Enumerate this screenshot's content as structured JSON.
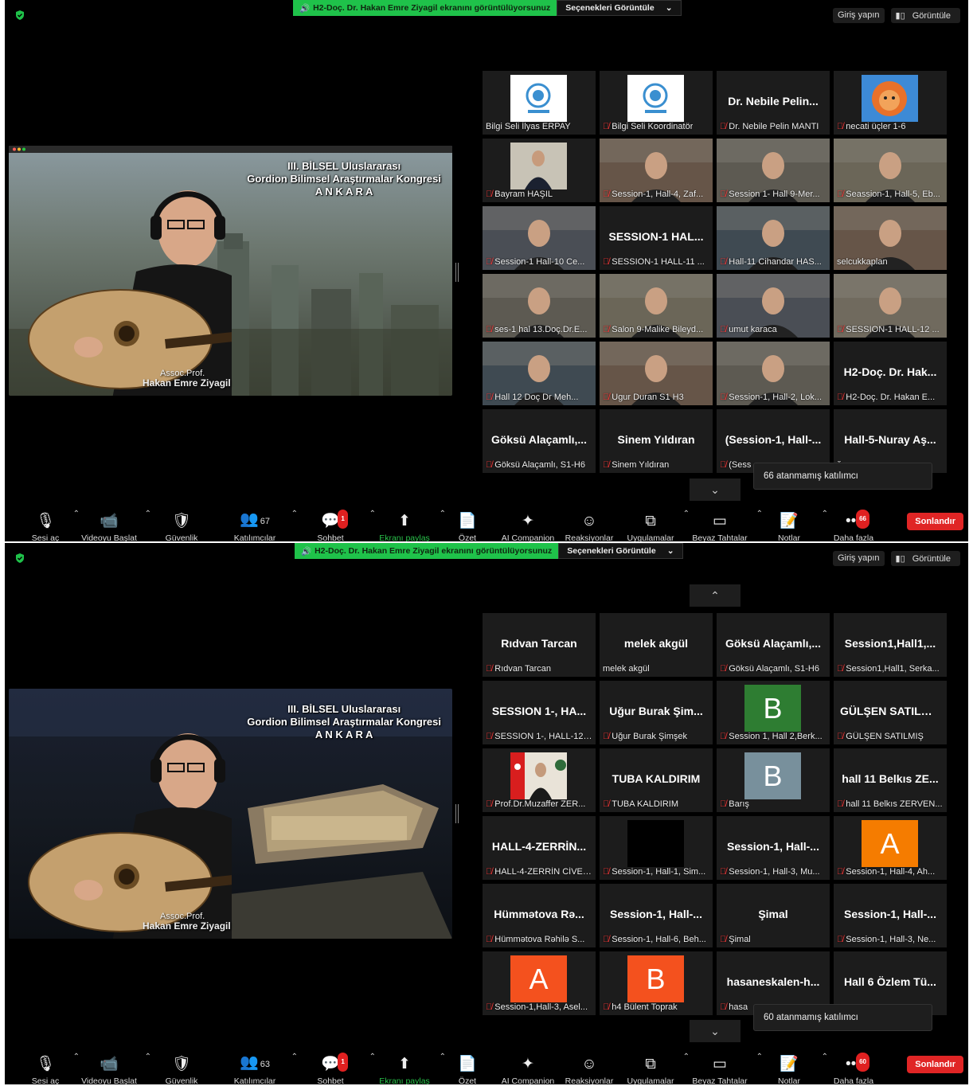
{
  "windows": [
    {
      "banner_text": "H2-Doç. Dr. Hakan Emre Ziyagil ekranını görüntülüyorsunuz",
      "options_label": "Seçenekleri Görüntüle",
      "sign_in": "Giriş yapın",
      "view_label": "Görüntüle",
      "screen": {
        "title": [
          "III. BİLSEL Uluslararası",
          "Gordion Bilimsel Araştırmalar Kongresi",
          "A N K A R A"
        ],
        "caption_role": "Assoc.Prof.",
        "caption_name": "Hakan Emre Ziyagil"
      },
      "tiles": [
        {
          "name": "Bilgi Seli İlyas ERPAY",
          "muted": false,
          "kind": "logo"
        },
        {
          "name": "Bilgi Seli Koordinatör",
          "muted": true,
          "kind": "logo"
        },
        {
          "name": "Dr. Nebile Pelin MANTI",
          "muted": true,
          "kind": "text",
          "big": "Dr. Nebile Pelin..."
        },
        {
          "name": "necati üçler 1-6",
          "muted": true,
          "kind": "lion"
        },
        {
          "name": "Bayram HAŞIL",
          "muted": true,
          "kind": "photo"
        },
        {
          "name": "Session-1, Hall-4, Zaf...",
          "muted": true,
          "kind": "video"
        },
        {
          "name": "Session 1- Hall 9-Mer...",
          "muted": true,
          "kind": "video"
        },
        {
          "name": "Seassion-1, Hall-5, Eb...",
          "muted": true,
          "kind": "video"
        },
        {
          "name": "Session-1  Hall-10 Ce...",
          "muted": true,
          "kind": "video"
        },
        {
          "name": "SESSION-1 HALL-11 ...",
          "muted": true,
          "kind": "text",
          "big": "SESSION-1 HAL..."
        },
        {
          "name": "Hall-11 Cihandar HAS...",
          "muted": true,
          "kind": "video"
        },
        {
          "name": "selcukkaplan",
          "muted": false,
          "kind": "video"
        },
        {
          "name": "ses-1 hal 13.Doç.Dr.E...",
          "muted": true,
          "kind": "video"
        },
        {
          "name": "Salon 9-Malike Bileyd...",
          "muted": true,
          "kind": "video"
        },
        {
          "name": "umut karaca",
          "muted": true,
          "kind": "video"
        },
        {
          "name": "SESSION-1 HALL-12 ...",
          "muted": true,
          "kind": "video"
        },
        {
          "name": "Hall 12  Doç Dr Meh...",
          "muted": true,
          "kind": "video",
          "highlight": true
        },
        {
          "name": "Ugur Duran S1 H3",
          "muted": true,
          "kind": "video"
        },
        {
          "name": "Session-1, Hall-2, Lok...",
          "muted": true,
          "kind": "video"
        },
        {
          "name": "H2-Doç. Dr. Hakan E...",
          "muted": true,
          "kind": "text",
          "big": "H2-Doç. Dr. Hak..."
        },
        {
          "name": "Göksü Alaçamlı, S1-H6",
          "muted": true,
          "kind": "text",
          "big": "Göksü  Alaçamlı,..."
        },
        {
          "name": "Sinem Yıldıran",
          "muted": true,
          "kind": "text",
          "big": "Sinem Yıldıran"
        },
        {
          "name": "(Sess",
          "muted": true,
          "kind": "text",
          "big": "(Session-1,  Hall-..."
        },
        {
          "name": "ğ...",
          "muted": false,
          "kind": "text",
          "big": "Hall-5-Nuray Aş..."
        }
      ],
      "popup": "66 atanmamış katılımcı",
      "participants_count": "67",
      "chat_badge": "1",
      "more_badge": "66"
    },
    {
      "banner_text": "H2-Doç. Dr. Hakan Emre Ziyagil ekranını görüntülüyorsunuz",
      "options_label": "Seçenekleri Görüntüle",
      "sign_in": "Giriş yapın",
      "view_label": "Görüntüle",
      "screen": {
        "title": [
          "III. BİLSEL Uluslararası",
          "Gordion Bilimsel Araştırmalar Kongresi",
          "A N K A R A"
        ],
        "caption_role": "Assoc.Prof.",
        "caption_name": "Hakan Emre Ziyagil"
      },
      "tiles": [
        {
          "name": "Rıdvan Tarcan",
          "muted": true,
          "kind": "text",
          "big": "Rıdvan Tarcan"
        },
        {
          "name": "melek akgül",
          "muted": false,
          "kind": "text",
          "big": "melek akgül"
        },
        {
          "name": "Göksü Alaçamlı, S1-H6",
          "muted": true,
          "kind": "text",
          "big": "Göksü  Alaçamlı,..."
        },
        {
          "name": "Session1,Hall1, Serka...",
          "muted": true,
          "kind": "text",
          "big": "Session1,Hall1,..."
        },
        {
          "name": "SESSION 1-, HALL-12,...",
          "muted": true,
          "kind": "text",
          "big": "SESSION  1-,  HA..."
        },
        {
          "name": "Uğur Burak Şimşek",
          "muted": true,
          "kind": "text",
          "big": "Uğur Burak Şim..."
        },
        {
          "name": "Session 1, Hall 2,Berk...",
          "muted": true,
          "kind": "letter",
          "letter": "B",
          "color": "#2e7d32"
        },
        {
          "name": "GÜLŞEN SATILMIŞ",
          "muted": true,
          "kind": "text",
          "big": "GÜLŞEN SATILMIŞ"
        },
        {
          "name": "Prof.Dr.Muzaffer ZER...",
          "muted": true,
          "kind": "flag"
        },
        {
          "name": "TUBA KALDIRIM",
          "muted": true,
          "kind": "text",
          "big": "TUBA KALDIRIM"
        },
        {
          "name": "Barış",
          "muted": true,
          "kind": "letter",
          "letter": "B",
          "color": "#78909c"
        },
        {
          "name": "hall 11 Belkıs ZERVEN...",
          "muted": true,
          "kind": "text",
          "big": "hall 11 Belkıs ZE..."
        },
        {
          "name": "HALL-4-ZERRİN CİVEL...",
          "muted": true,
          "kind": "text",
          "big": "HALL-4-ZERRİN..."
        },
        {
          "name": "Session-1, Hall-1, Sim...",
          "muted": true,
          "kind": "black"
        },
        {
          "name": "Session-1, Hall-3, Mu...",
          "muted": true,
          "kind": "text",
          "big": "Session-1,  Hall-..."
        },
        {
          "name": "Session-1, Hall-4, Ah...",
          "muted": true,
          "kind": "letter",
          "letter": "A",
          "color": "#f57c00"
        },
        {
          "name": "Hümmətova Rəhilə S...",
          "muted": true,
          "kind": "text",
          "big": "Hümmətova  Rə..."
        },
        {
          "name": "Session-1, Hall-6, Beh...",
          "muted": true,
          "kind": "text",
          "big": "Session-1,  Hall-..."
        },
        {
          "name": "Şimal",
          "muted": true,
          "kind": "text",
          "big": "Şimal"
        },
        {
          "name": "Session-1, Hall-3, Ne...",
          "muted": true,
          "kind": "text",
          "big": "Session-1,  Hall-..."
        },
        {
          "name": "Session-1,Hall-3, Asel...",
          "muted": true,
          "kind": "letter",
          "letter": "A",
          "color": "#f4511e"
        },
        {
          "name": "h4 Bülent Toprak",
          "muted": true,
          "kind": "letter",
          "letter": "B",
          "color": "#f4511e"
        },
        {
          "name": "hasa",
          "muted": true,
          "kind": "text",
          "big": "hasaneskalen-h..."
        },
        {
          "name": "y...",
          "muted": false,
          "kind": "text",
          "big": "Hall 6 Özlem Tü..."
        }
      ],
      "popup": "60 atanmamış katılımcı",
      "participants_count": "63",
      "chat_badge": "1",
      "more_badge": "60"
    }
  ],
  "toolbar": {
    "unmute": "Sesi aç",
    "start_video": "Videoyu Başlat",
    "security": "Güvenlik",
    "participants": "Katılımcılar",
    "chat": "Sohbet",
    "share": "Ekranı paylaş",
    "summary": "Özet",
    "ai": "AI Companion",
    "reactions": "Reaksiyonlar",
    "apps": "Uygulamalar",
    "whiteboard": "Beyaz Tahtalar",
    "notes": "Notlar",
    "more": "Daha fazla",
    "end": "Sonlandır"
  },
  "colors": {
    "accent_green": "#1fc24a",
    "end_red": "#e02525",
    "highlight": "#d4e157"
  }
}
